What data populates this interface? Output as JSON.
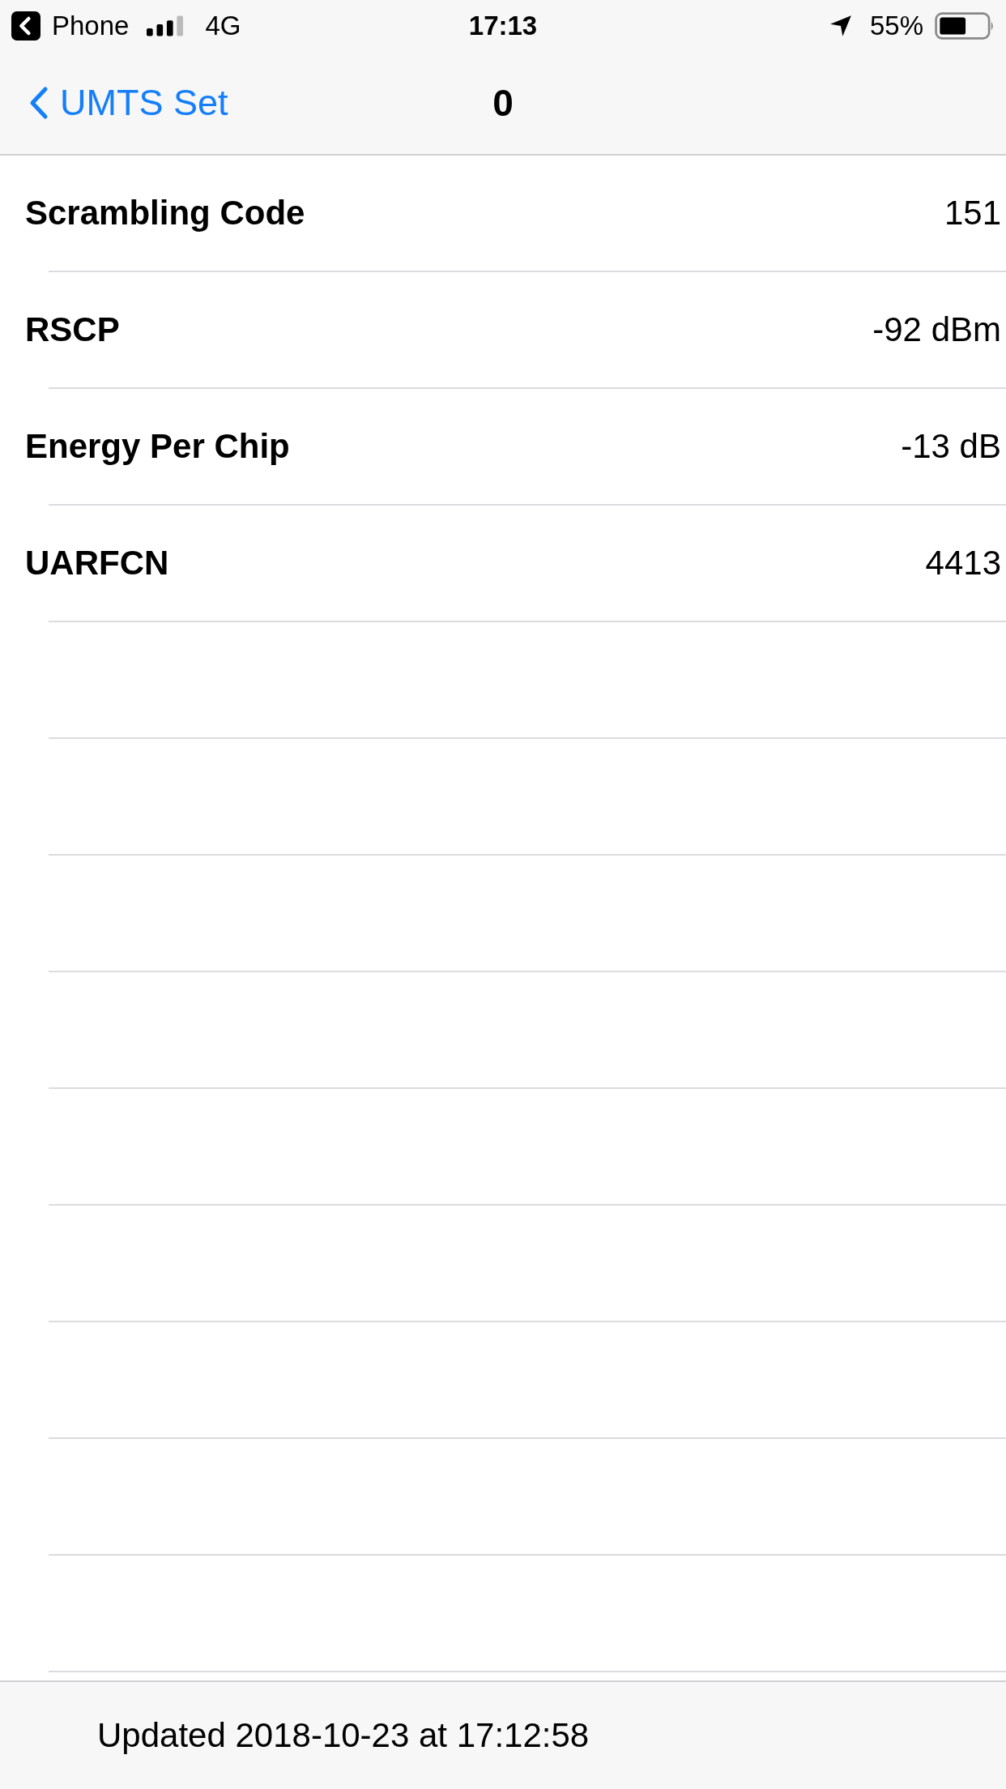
{
  "status_bar": {
    "back_app": "Phone",
    "network": "4G",
    "time": "17:13",
    "battery": "55%"
  },
  "nav": {
    "back": "UMTS Set",
    "title": "0"
  },
  "rows": [
    {
      "label": "Scrambling Code",
      "value": "151"
    },
    {
      "label": "RSCP",
      "value": "-92 dBm"
    },
    {
      "label": "Energy Per Chip",
      "value": "-13 dB"
    },
    {
      "label": "UARFCN",
      "value": "4413"
    }
  ],
  "footer": "Updated 2018-10-23 at 17:12:58"
}
